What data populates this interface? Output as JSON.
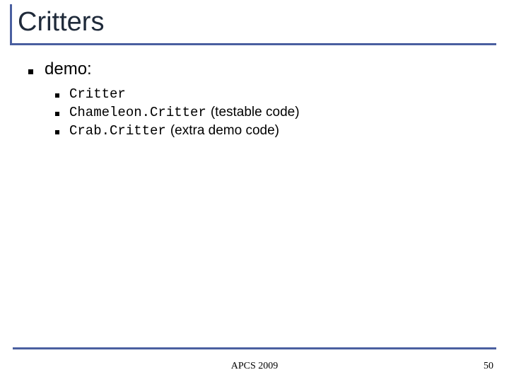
{
  "title": "Critters",
  "level1": "demo:",
  "items": [
    {
      "code": "Critter",
      "note": ""
    },
    {
      "code": "Chameleon.Critter",
      "note": "(testable code)"
    },
    {
      "code": "Crab.Critter",
      "note": "(extra demo code)"
    }
  ],
  "footer": "APCS 2009",
  "page": "50"
}
